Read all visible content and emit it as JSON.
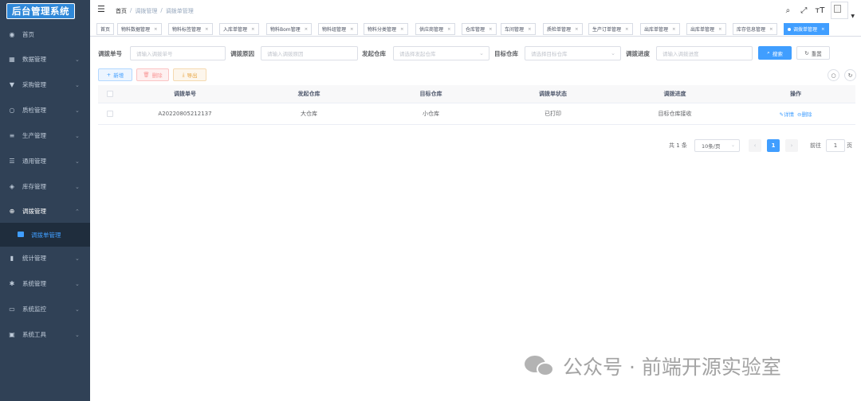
{
  "app": {
    "logo_text": "后台管理系统"
  },
  "sidebar": {
    "items": [
      {
        "label": "首页",
        "icon": "dashboard-icon",
        "has_children": false
      },
      {
        "label": "数据管理",
        "icon": "table-icon",
        "has_children": true
      },
      {
        "label": "采购管理",
        "icon": "cart-icon",
        "has_children": true
      },
      {
        "label": "质检管理",
        "icon": "search-icon",
        "has_children": true
      },
      {
        "label": "生产管理",
        "icon": "sliders-icon",
        "has_children": true
      },
      {
        "label": "通用管理",
        "icon": "list-icon",
        "has_children": true
      },
      {
        "label": "库存管理",
        "icon": "layers-icon",
        "has_children": true
      },
      {
        "label": "调拨管理",
        "icon": "plus-circle-icon",
        "has_children": true,
        "open": true
      },
      {
        "label": "统计管理",
        "icon": "bar-chart-icon",
        "has_children": true
      },
      {
        "label": "系统管理",
        "icon": "gear-icon",
        "has_children": true
      },
      {
        "label": "系统监控",
        "icon": "monitor-icon",
        "has_children": true
      },
      {
        "label": "系统工具",
        "icon": "toolbox-icon",
        "has_children": true
      }
    ],
    "submenu": {
      "label": "调拨单管理"
    }
  },
  "header": {
    "breadcrumb": [
      "首页",
      "调拨管理",
      "调拨单管理"
    ],
    "separator": "/"
  },
  "tags": [
    {
      "label": "首页",
      "closable": false
    },
    {
      "label": "物料数据管理",
      "closable": true
    },
    {
      "label": "物料标签管理",
      "closable": true
    },
    {
      "label": "入库单管理",
      "closable": true
    },
    {
      "label": "物料Bom管理",
      "closable": true
    },
    {
      "label": "物料组管理",
      "closable": true
    },
    {
      "label": "物料分类管理",
      "closable": true
    },
    {
      "label": "供应商管理",
      "closable": true
    },
    {
      "label": "仓库管理",
      "closable": true
    },
    {
      "label": "车间管理",
      "closable": true
    },
    {
      "label": "质检单管理",
      "closable": true
    },
    {
      "label": "生产订单管理",
      "closable": true
    },
    {
      "label": "出库单管理",
      "closable": true
    },
    {
      "label": "出库单管理",
      "closable": true
    },
    {
      "label": "库存信息管理",
      "closable": true
    },
    {
      "label": "调拨单管理",
      "closable": true,
      "active": true
    }
  ],
  "search_form": {
    "transfer_no": {
      "label": "调拨单号",
      "placeholder": "请输入调拨单号"
    },
    "reason": {
      "label": "调拨原因",
      "placeholder": "请输入调拨原因"
    },
    "source_wh": {
      "label": "发起仓库",
      "placeholder": "请选择发起仓库"
    },
    "target_wh": {
      "label": "目标仓库",
      "placeholder": "请选择目标仓库"
    },
    "progress": {
      "label": "调拨进度",
      "placeholder": "请输入调拨进度"
    },
    "search_button": "搜索",
    "reset_button": "重置"
  },
  "toolbar": {
    "add": "新增",
    "delete": "删除",
    "export": "导出"
  },
  "table": {
    "columns": [
      "调拨单号",
      "发起仓库",
      "目标仓库",
      "调拨单状态",
      "调拨进度",
      "操作"
    ],
    "rows": [
      {
        "transfer_no": "A20220805212137",
        "source_wh": "大仓库",
        "target_wh": "小仓库",
        "status": "已打印",
        "progress": "目标仓库接收",
        "actions": [
          "详情",
          "删除"
        ]
      }
    ]
  },
  "pagination": {
    "total_text": "共 1 条",
    "page_size": "10条/页",
    "current_page": "1",
    "goto_label": "前往",
    "goto_value": "1",
    "unit": "页"
  },
  "watermark": {
    "text": "公众号 · 前端开源实验室"
  },
  "colors": {
    "primary": "#409eff",
    "sidebar_bg": "#304156",
    "submenu_bg": "#1f2d3d",
    "danger": "#f56c6c",
    "warning": "#e6a23c"
  }
}
